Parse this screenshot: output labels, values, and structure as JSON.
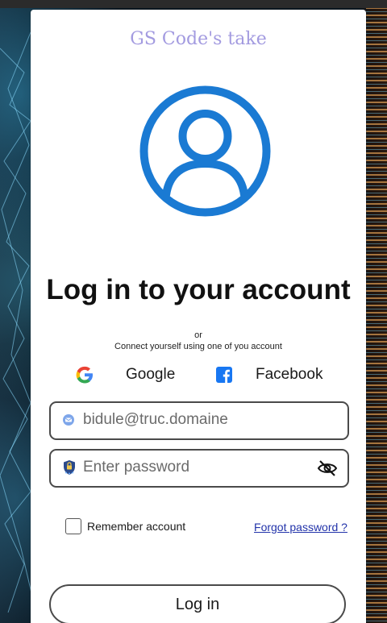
{
  "brand": "GS Code's take",
  "title": "Log in to your account",
  "or_text": "or",
  "connect_text": "Connect yourself using one of you account",
  "social": {
    "google": {
      "label": "Google",
      "icon": "google-icon"
    },
    "facebook": {
      "label": "Facebook",
      "icon": "facebook-icon"
    }
  },
  "email": {
    "placeholder": "bidule@truc.domaine",
    "value": "",
    "icon": "email-icon"
  },
  "password": {
    "placeholder": "Enter password",
    "value": "",
    "icon": "lock-badge-icon",
    "toggle_icon": "eye-off-icon"
  },
  "remember_label": "Remember account",
  "remember_checked": false,
  "forgot_label": "Forgot password ?",
  "login_label": "Log in",
  "colors": {
    "brand": "#a39be0",
    "avatar": "#1a7ad3",
    "link": "#2233aa",
    "facebook": "#1877f2"
  }
}
